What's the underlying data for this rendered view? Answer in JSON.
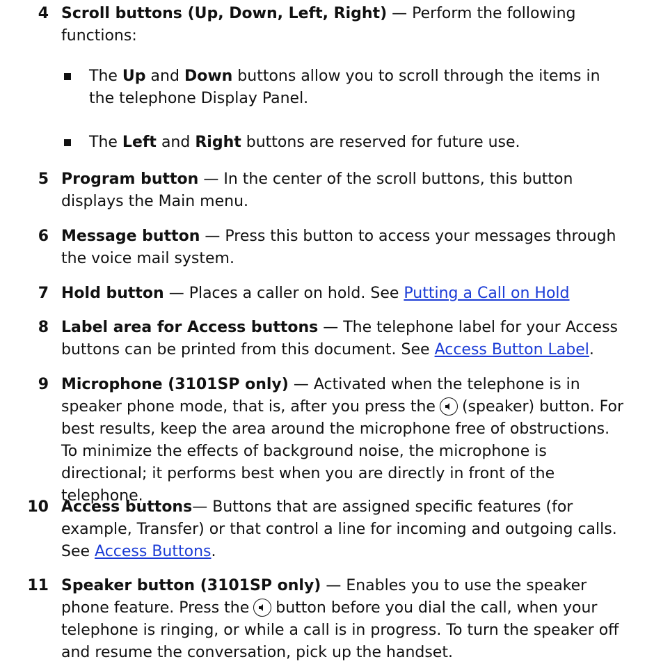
{
  "items": [
    {
      "num": "4",
      "term": "Scroll buttons (Up, Down, Left, Right)",
      "text": " — Perform the following functions:",
      "bullets": [
        {
          "pre": "The ",
          "b1": "Up",
          "mid": " and ",
          "b2": "Down",
          "post": " buttons allow you to scroll through the items in the telephone Display Panel."
        },
        {
          "pre": "The ",
          "b1": "Left",
          "mid": " and ",
          "b2": "Right",
          "post": " buttons are reserved for future use."
        }
      ]
    },
    {
      "num": "5",
      "term": "Program button",
      "text": " — In the center of the scroll buttons, this button displays the Main menu."
    },
    {
      "num": "6",
      "term": "Message button",
      "text": " — Press this button to access your messages through the voice mail system."
    },
    {
      "num": "7",
      "term": "Hold button",
      "text": " — Places a caller on hold. See ",
      "link": "Putting a Call on Hold"
    },
    {
      "num": "8",
      "term": "Label area for Access buttons",
      "text": " — The telephone label for your Access buttons can be printed from this document. See ",
      "link": "Access Button Label",
      "after": "."
    },
    {
      "num": "9",
      "term": "Microphone (3101SP only)",
      "text": " — Activated when the telephone is in speaker phone mode, that is, after you press the",
      "after": "(speaker) button. For best results, keep the area around the microphone free of obstructions. To minimize the effects of background noise, the microphone is directional; it performs best when you are directly in front of the telephone."
    },
    {
      "num": "10",
      "term": "Access buttons",
      "text": "— Buttons that are assigned specific features (for example, Transfer) or that control a line for incoming and outgoing calls. See ",
      "link": "Access Buttons",
      "after": "."
    },
    {
      "num": "11",
      "term": "Speaker button (3101SP only)",
      "text": " — Enables you to use the speaker phone feature. Press the",
      "after": "button before you dial the call, when your telephone is ringing, or while a call is in progress. To turn the speaker off and resume the conversation, pick up the handset."
    }
  ]
}
